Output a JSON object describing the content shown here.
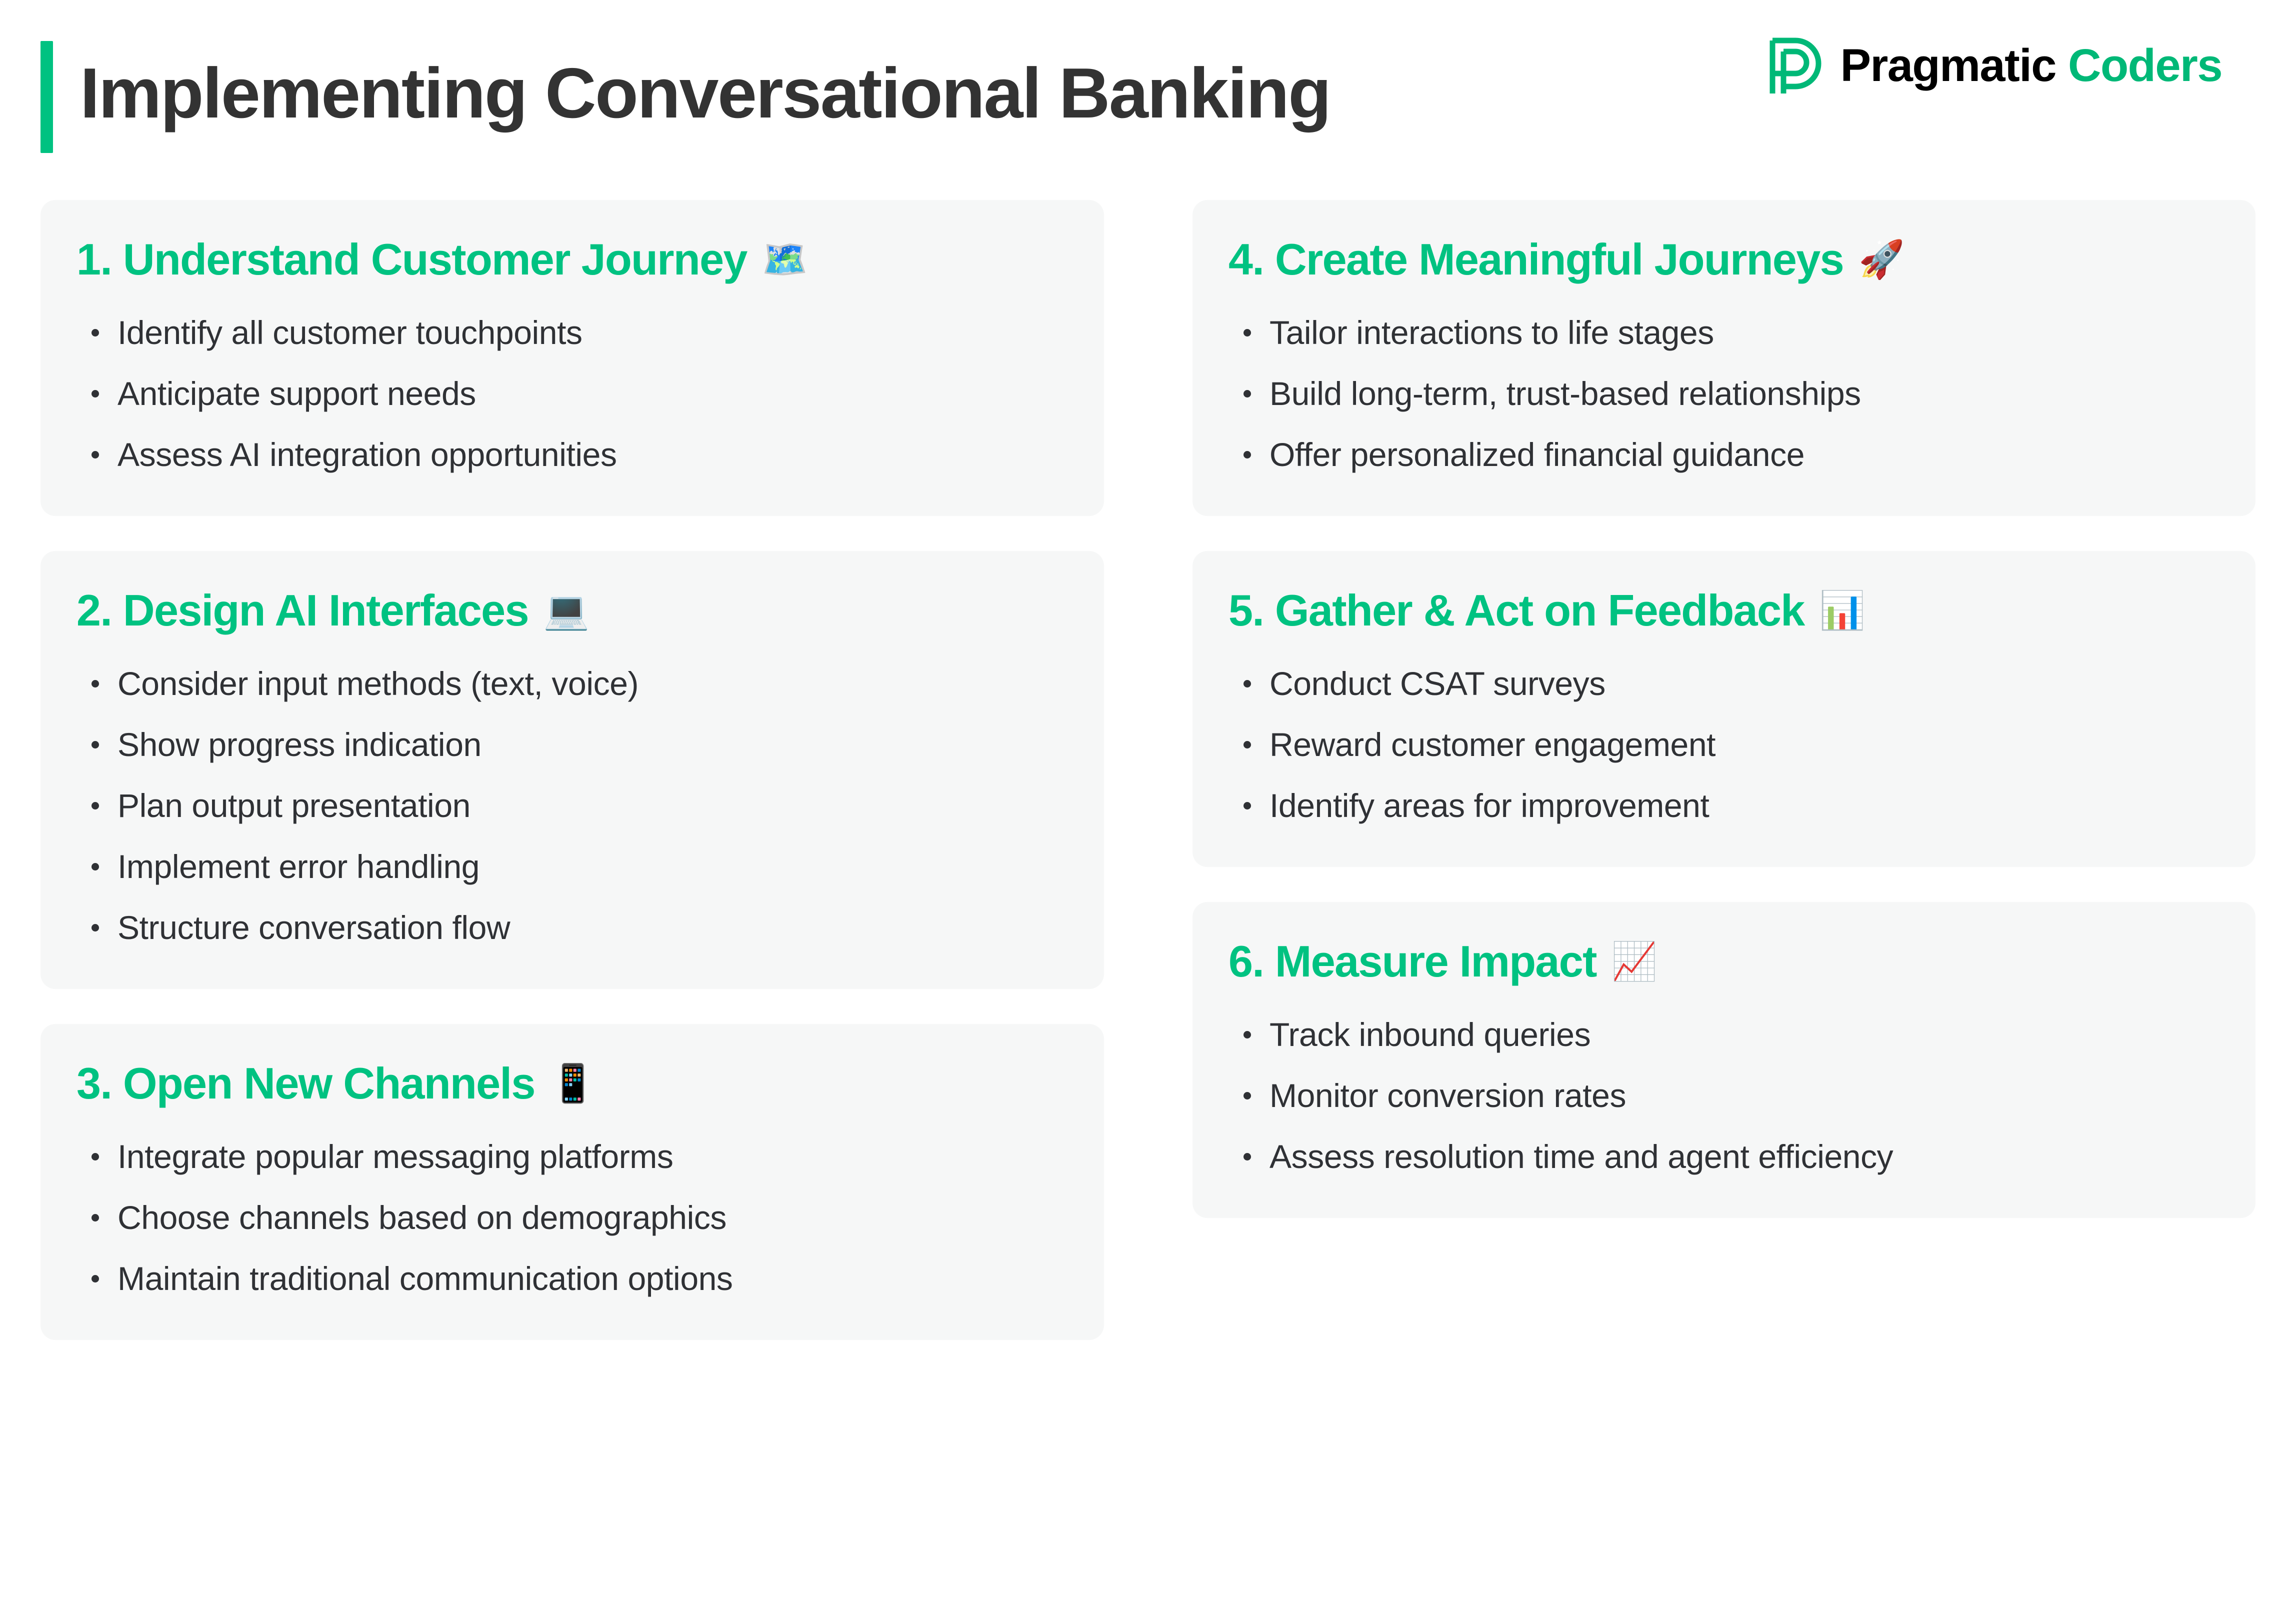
{
  "header": {
    "title": "Implementing Conversational Banking",
    "accent_color": "#00c281",
    "title_color": "#333333",
    "brand": {
      "mark_icon": "pragmatic-coders-p-logo-icon",
      "word_1": "Pragmatic",
      "word_2": "Coders",
      "word_1_color": "#000000",
      "word_2_color": "#00b877"
    }
  },
  "cards": [
    {
      "heading": "1. Understand Customer Journey",
      "emoji": "🗺️",
      "emoji_name": "world-map-icon",
      "bullets": [
        "Identify all customer touchpoints",
        "Anticipate support needs",
        "Assess AI integration opportunities"
      ]
    },
    {
      "heading": "2. Design AI Interfaces",
      "emoji": "💻",
      "emoji_name": "laptop-icon",
      "bullets": [
        "Consider input methods (text, voice)",
        "Show progress indication",
        "Plan output presentation",
        "Implement error handling",
        "Structure conversation flow"
      ]
    },
    {
      "heading": "3. Open New Channels",
      "emoji": "📱",
      "emoji_name": "mobile-phone-icon",
      "bullets": [
        "Integrate popular messaging platforms",
        "Choose channels based on demographics",
        "Maintain traditional communication options"
      ]
    },
    {
      "heading": "4. Create Meaningful Journeys",
      "emoji": "🚀",
      "emoji_name": "rocket-icon",
      "bullets": [
        "Tailor interactions to life stages",
        "Build long-term, trust-based relationships",
        "Offer personalized financial guidance"
      ]
    },
    {
      "heading": "5. Gather & Act on Feedback",
      "emoji": "📊",
      "emoji_name": "bar-chart-icon",
      "bullets": [
        "Conduct CSAT surveys",
        "Reward customer engagement",
        "Identify areas for improvement"
      ]
    },
    {
      "heading": "6. Measure Impact",
      "emoji": "📈",
      "emoji_name": "chart-increasing-icon",
      "bullets": [
        "Track inbound queries",
        "Monitor conversion rates",
        "Assess resolution time and agent efficiency"
      ]
    }
  ],
  "layout": {
    "left_column_card_indices": [
      0,
      1,
      2
    ],
    "right_column_card_indices": [
      3,
      4,
      5
    ],
    "card_background": "#f6f7f7",
    "page_background": "#ffffff",
    "heading_color": "#00c281",
    "bullet_text_color": "#2f3135"
  }
}
